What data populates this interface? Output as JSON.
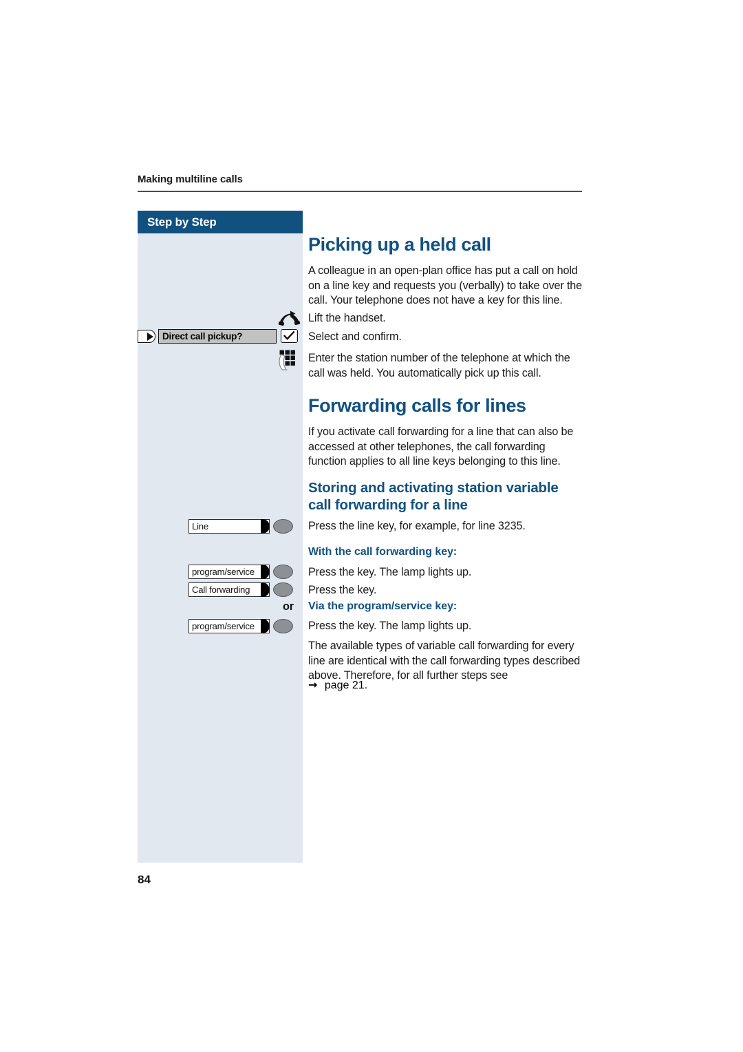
{
  "header": {
    "running_title": "Making multiline calls"
  },
  "sidebar": {
    "title": "Step by Step",
    "or_label": "or"
  },
  "folio": {
    "page_number": "84"
  },
  "colors": {
    "accent_blue": "#115180",
    "sidebar_bg": "#e2e8f0",
    "display_field_bg": "#c2c2c2",
    "key_cap": "#8d9196",
    "rule": "#4d4d4d"
  },
  "sections": {
    "picking_up": {
      "heading": "Picking up a held call",
      "intro": "A colleague in an open-plan office has put a call on hold on a line key and requests you (verbally) to take over the call. Your telephone does not have a key for this line.",
      "steps": [
        {
          "icon": "handset-lift-icon",
          "text": "Lift the handset."
        },
        {
          "icon": "checkmark-key-icon",
          "display_text": "Direct call pickup?",
          "nav_icon": "nav-right-key-icon",
          "text": "Select and confirm."
        },
        {
          "icon": "keypad-icon",
          "text": "Enter the station number of the telephone at which the call was held. You automatically pick up this call."
        }
      ]
    },
    "forwarding": {
      "heading": "Forwarding calls for lines",
      "intro": "If you activate call forwarding for a line that can also be accessed at other telephones, the call forwarding function applies to all line keys belonging to this line."
    },
    "storing": {
      "heading_line1": "Storing and activating station variable",
      "heading_line2": "call forwarding for a line",
      "line_key": {
        "label": "Line",
        "text": "Press the line key, for example, for line 3235."
      },
      "sub_heading_1": "With the call forwarding key:",
      "rows": [
        {
          "label": "program/service",
          "text": "Press the key. The lamp lights up."
        },
        {
          "label": "Call forwarding",
          "text": "Press the key."
        }
      ],
      "sub_heading_2": "Via the program/service key:",
      "rows2": [
        {
          "label": "program/service",
          "text": "Press the key. The lamp lights up."
        }
      ],
      "closing": "The available types of variable call forwarding for every line are identical with the call forwarding types described above. Therefore, for all further steps see",
      "cross_ref_arrow": "→",
      "cross_ref": "page 21."
    }
  }
}
